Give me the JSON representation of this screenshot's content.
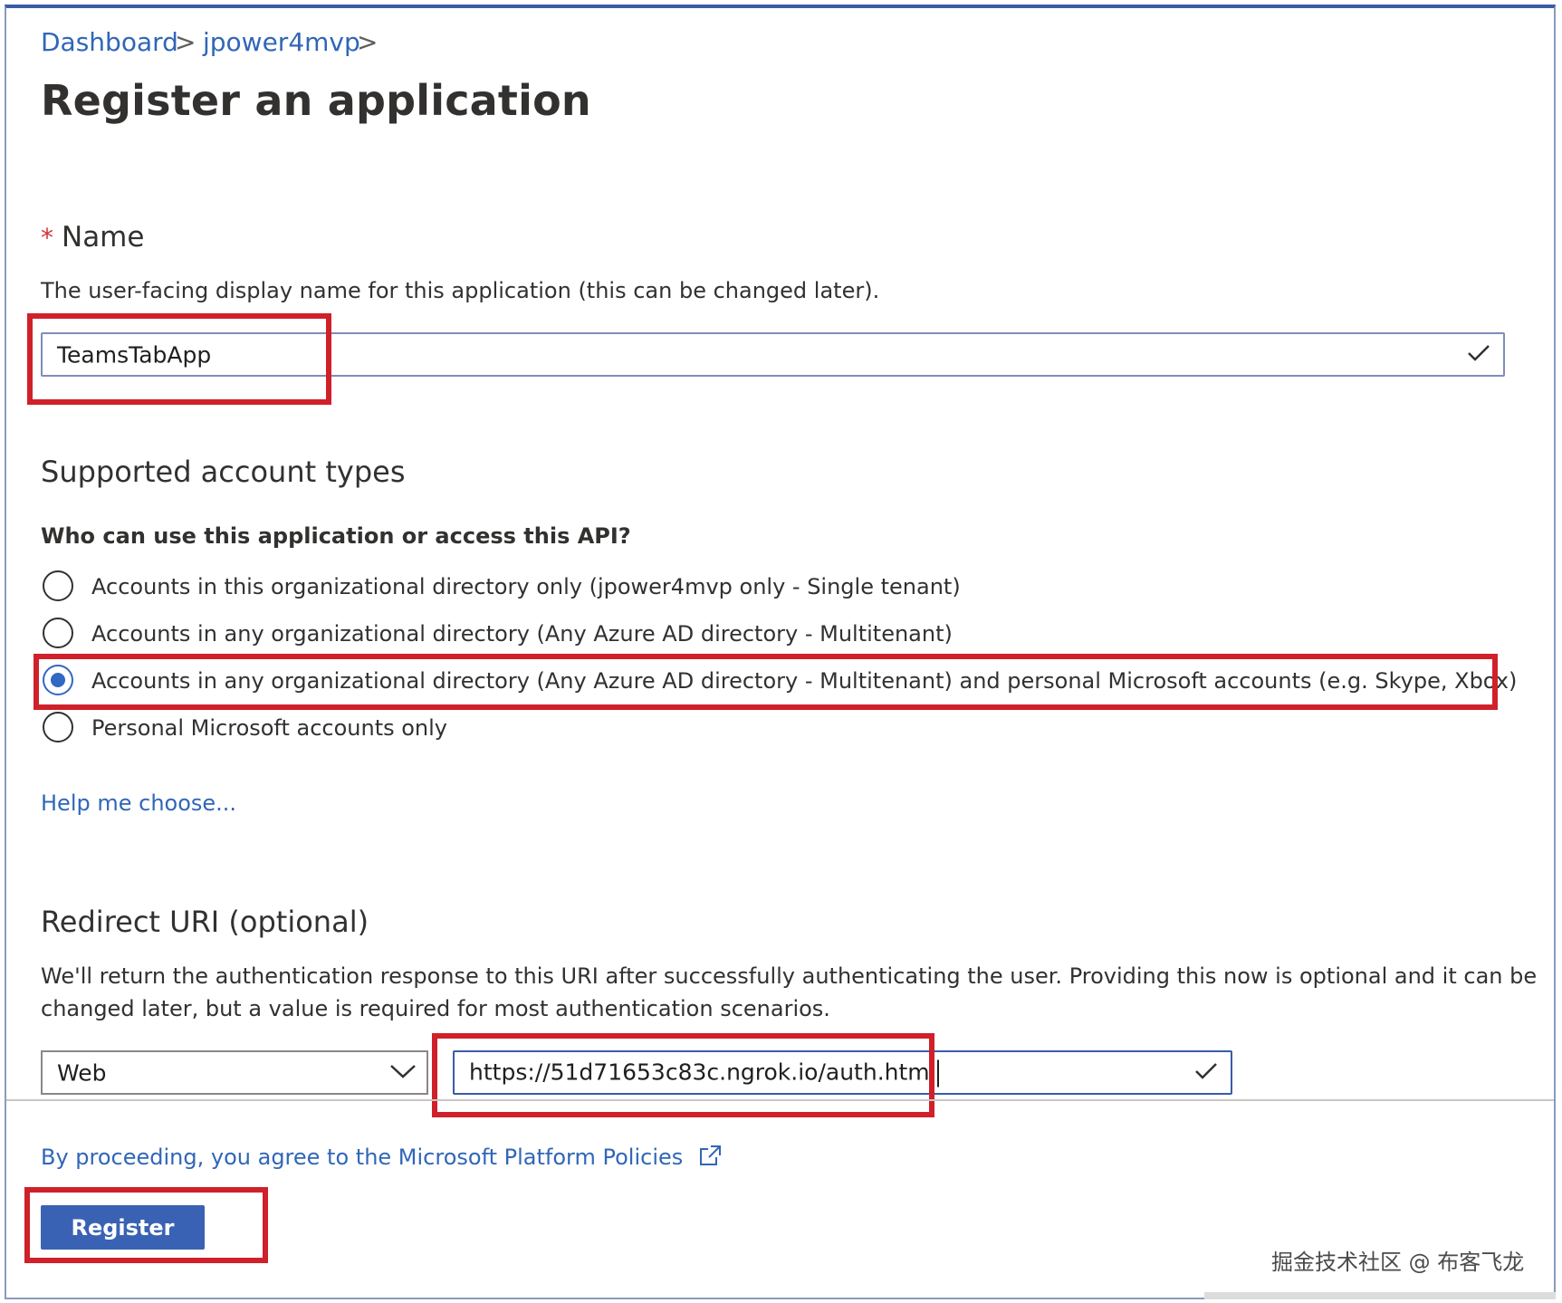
{
  "breadcrumb": {
    "items": [
      "Dashboard",
      "jpower4mvp"
    ],
    "separator": ">"
  },
  "page_title": "Register an application",
  "name_section": {
    "required_marker": "*",
    "label": "Name",
    "description": "The user-facing display name for this application (this can be changed later).",
    "value": "TeamsTabApp"
  },
  "account_types": {
    "heading": "Supported account types",
    "question": "Who can use this application or access this API?",
    "options": [
      {
        "label": "Accounts in this organizational directory only (jpower4mvp only - Single tenant)",
        "selected": false
      },
      {
        "label": "Accounts in any organizational directory (Any Azure AD directory - Multitenant)",
        "selected": false
      },
      {
        "label": "Accounts in any organizational directory (Any Azure AD directory - Multitenant) and personal Microsoft accounts (e.g. Skype, Xbox)",
        "selected": true
      },
      {
        "label": "Personal Microsoft accounts only",
        "selected": false
      }
    ],
    "help_link": "Help me choose..."
  },
  "redirect": {
    "heading": "Redirect URI (optional)",
    "description_line1": "We'll return the authentication response to this URI after successfully authenticating the user. Providing this now is optional and it can be",
    "description_line2": "changed later, but a value is required for most authentication scenarios.",
    "platform": "Web",
    "uri": "https://51d71653c83c.ngrok.io/auth.html"
  },
  "footer": {
    "policy_text": "By proceeding, you agree to the Microsoft Platform Policies",
    "register_label": "Register",
    "watermark": "掘金技术社区 @ 布客飞龙"
  },
  "colors": {
    "accent": "#3066b8",
    "primary_button": "#3a62b4",
    "highlight_red": "#d0202a"
  },
  "icons": {
    "checkmark": "checkmark-icon",
    "chevron": "chevron-down-icon",
    "external_link": "external-link-icon"
  }
}
